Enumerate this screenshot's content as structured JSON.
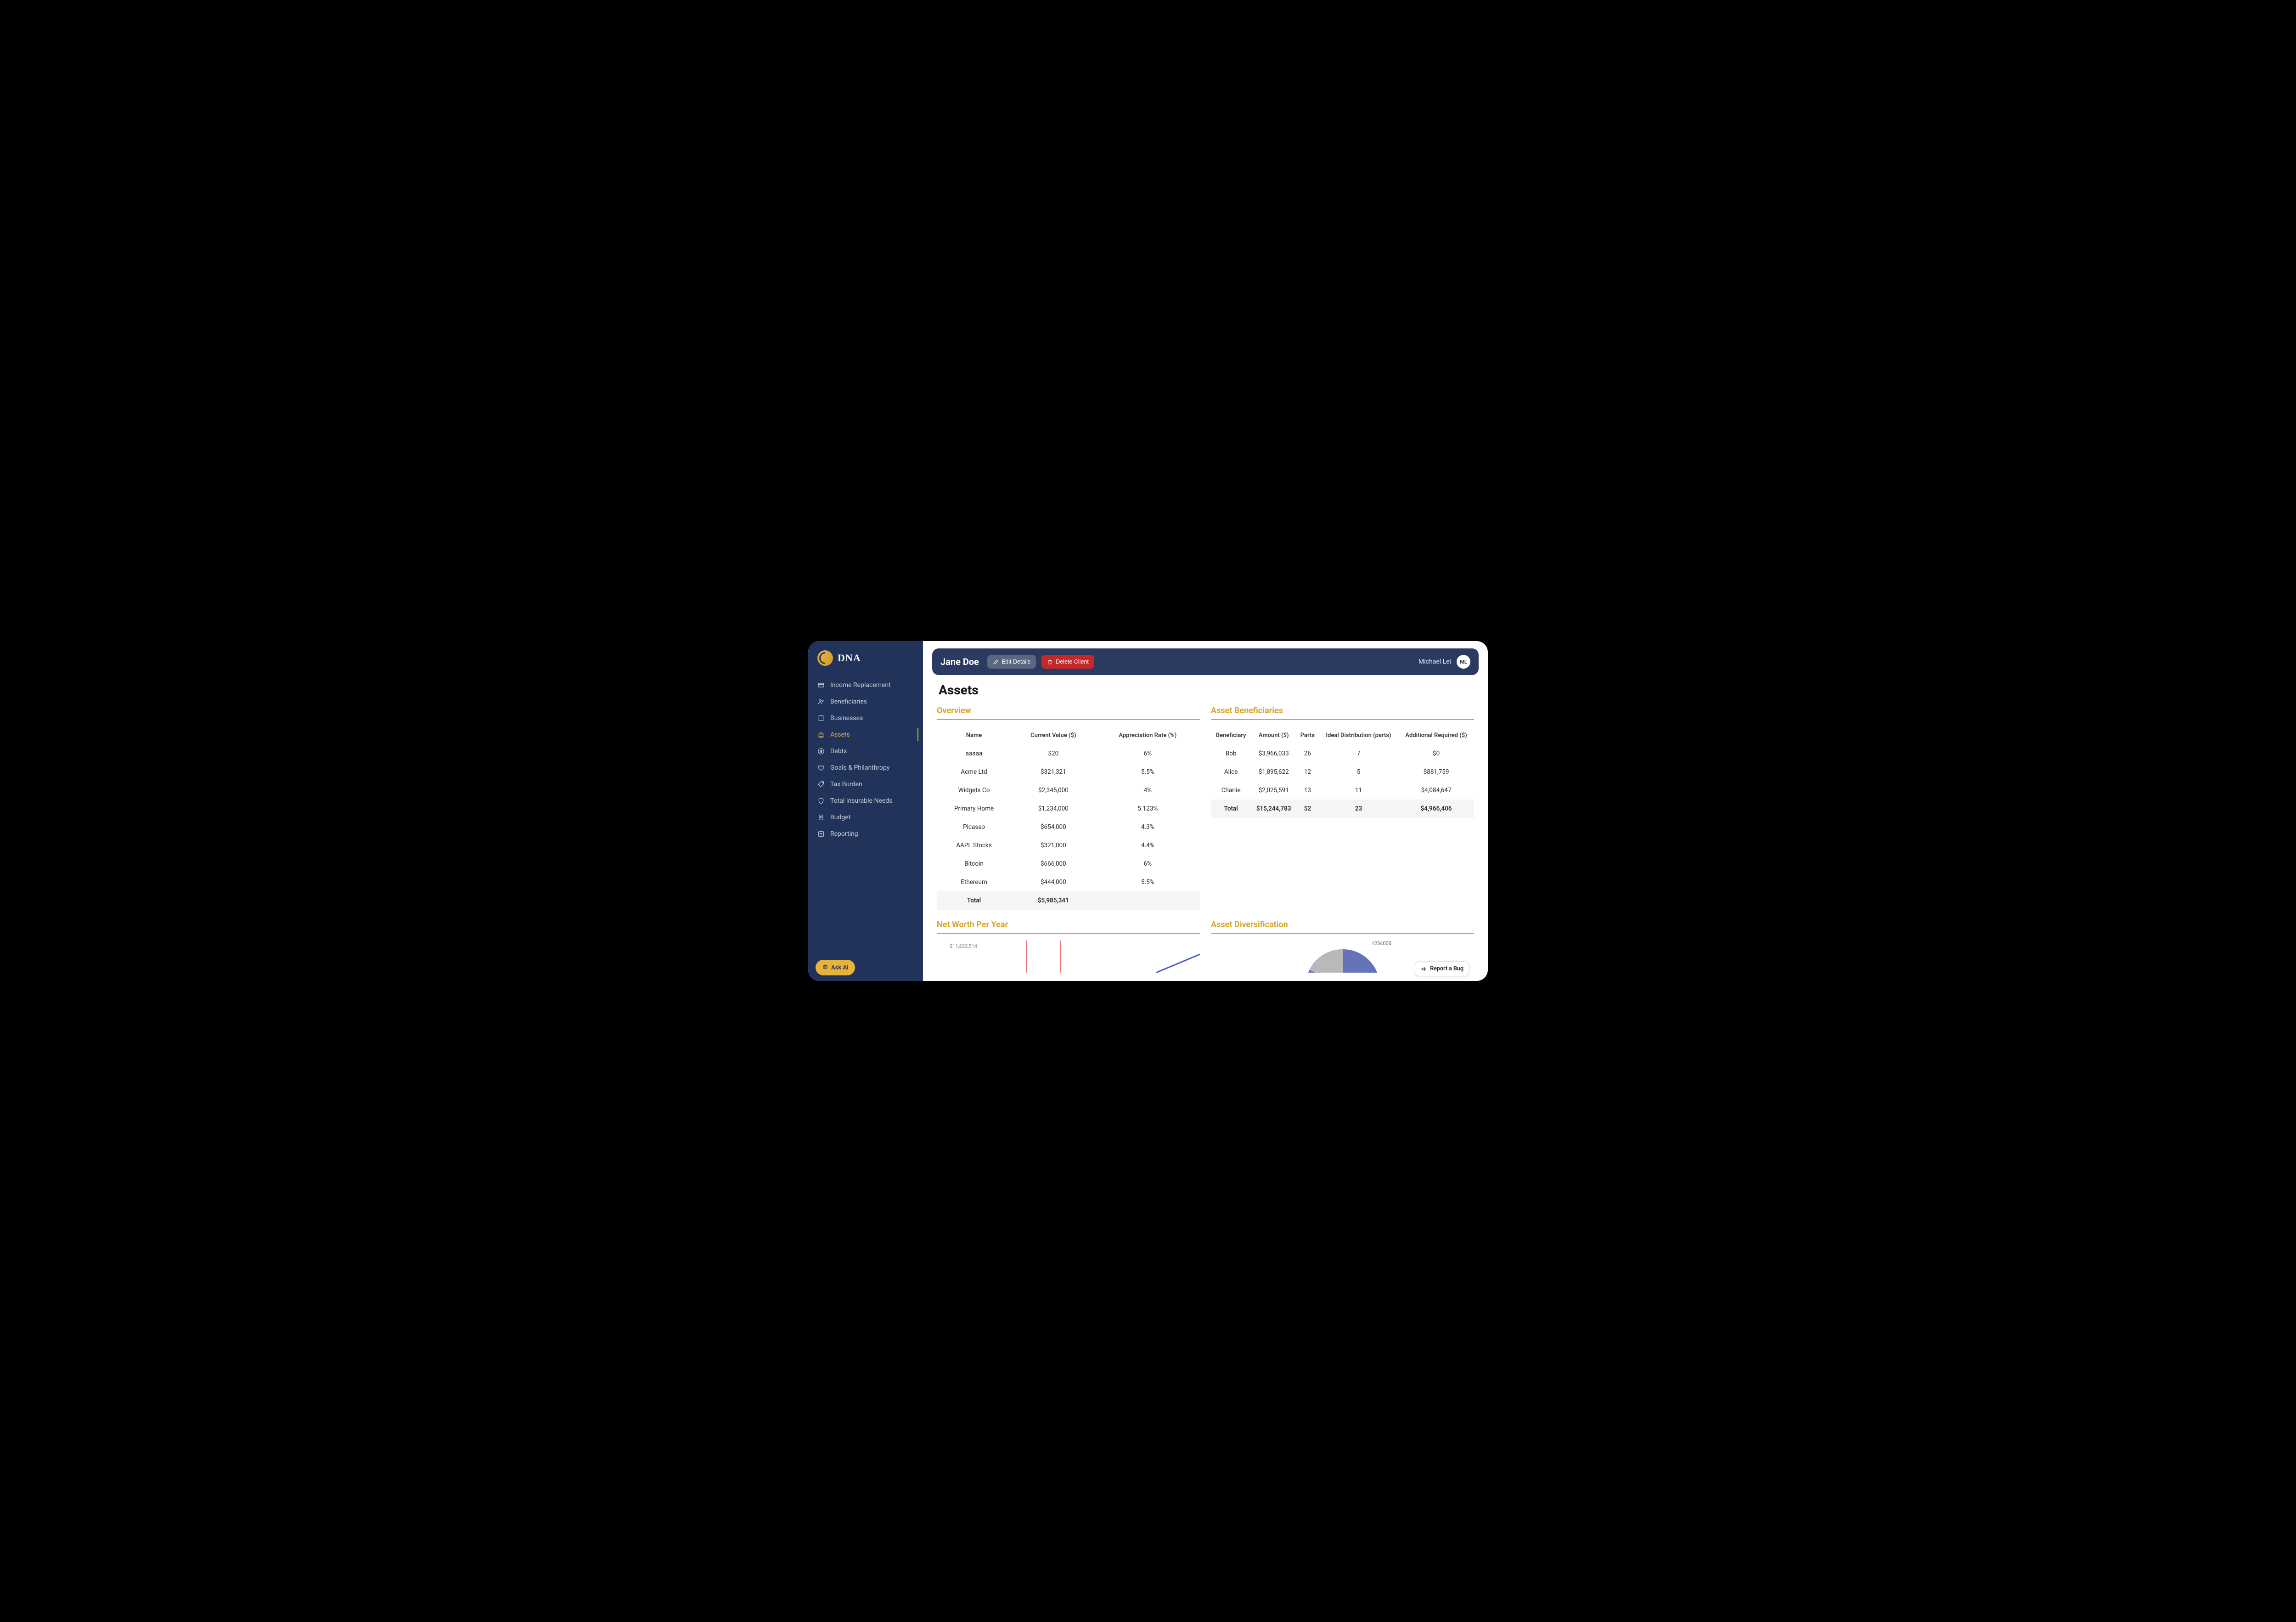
{
  "brand": {
    "name": "DNA"
  },
  "sidebar": {
    "items": [
      {
        "label": "Income Replacement",
        "key": "income-replacement"
      },
      {
        "label": "Beneficiaries",
        "key": "beneficiaries"
      },
      {
        "label": "Businesses",
        "key": "businesses"
      },
      {
        "label": "Assets",
        "key": "assets"
      },
      {
        "label": "Debts",
        "key": "debts"
      },
      {
        "label": "Goals & Philanthropy",
        "key": "goals"
      },
      {
        "label": "Tax Burden",
        "key": "tax"
      },
      {
        "label": "Total Insurable Needs",
        "key": "insurable"
      },
      {
        "label": "Budget",
        "key": "budget"
      },
      {
        "label": "Reporting",
        "key": "reporting"
      }
    ],
    "active_index": 3,
    "ask_ai_label": "Ask AI"
  },
  "topbar": {
    "client_name": "Jane Doe",
    "edit_label": "Edit Details",
    "delete_label": "Delete Client",
    "user_name": "Michael Lei",
    "user_initials": "ML"
  },
  "page": {
    "title": "Assets",
    "overview_title": "Overview",
    "beneficiaries_title": "Asset Beneficiaries",
    "networth_title": "Net Worth Per Year",
    "diversification_title": "Asset Diversification"
  },
  "overview_table": {
    "columns": [
      "Name",
      "Current Value ($)",
      "Appreciation Rate (%)"
    ],
    "rows": [
      {
        "name": "aaaaa",
        "value": "$20",
        "rate": "6%"
      },
      {
        "name": "Acme Ltd",
        "value": "$321,321",
        "rate": "5.5%"
      },
      {
        "name": "Widgets Co",
        "value": "$2,345,000",
        "rate": "4%"
      },
      {
        "name": "Primary Home",
        "value": "$1,234,000",
        "rate": "5.123%"
      },
      {
        "name": "Picasso",
        "value": "$654,000",
        "rate": "4.3%"
      },
      {
        "name": "AAPL Stocks",
        "value": "$321,000",
        "rate": "4.4%"
      },
      {
        "name": "Bitcoin",
        "value": "$666,000",
        "rate": "6%"
      },
      {
        "name": "Ethereum",
        "value": "$444,000",
        "rate": "5.5%"
      }
    ],
    "total": {
      "label": "Total",
      "value": "$5,985,341"
    }
  },
  "beneficiaries_table": {
    "columns": [
      "Beneficiary",
      "Amount ($)",
      "Parts",
      "Ideal Distribution (parts)",
      "Additional Required ($)"
    ],
    "rows": [
      {
        "name": "Bob",
        "amount": "$3,966,033",
        "parts": "26",
        "ideal": "7",
        "additional": "$0"
      },
      {
        "name": "Alice",
        "amount": "$1,895,622",
        "parts": "12",
        "ideal": "5",
        "additional": "$881,759"
      },
      {
        "name": "Charlie",
        "amount": "$2,025,591",
        "parts": "13",
        "ideal": "11",
        "additional": "$4,084,647"
      }
    ],
    "total": {
      "label": "Total",
      "amount": "$15,244,783",
      "parts": "52",
      "ideal": "23",
      "additional": "$4,966,406"
    }
  },
  "chart_data": [
    {
      "type": "line",
      "title": "Net Worth Per Year",
      "y_tick_visible": "$11,633,514",
      "ylim_visible_top": 11633514,
      "series": [
        {
          "name": "Net Worth",
          "values_note": "only upper-right segment of an increasing line is visible; data points not readable"
        }
      ]
    },
    {
      "type": "pie",
      "title": "Asset Diversification",
      "label_visible": "1234000",
      "slices_note": "partial pie visible at bottom; two slices visible (grey and blue), full breakdown not readable"
    }
  ],
  "footer": {
    "report_bug_label": "Report a Bug"
  }
}
